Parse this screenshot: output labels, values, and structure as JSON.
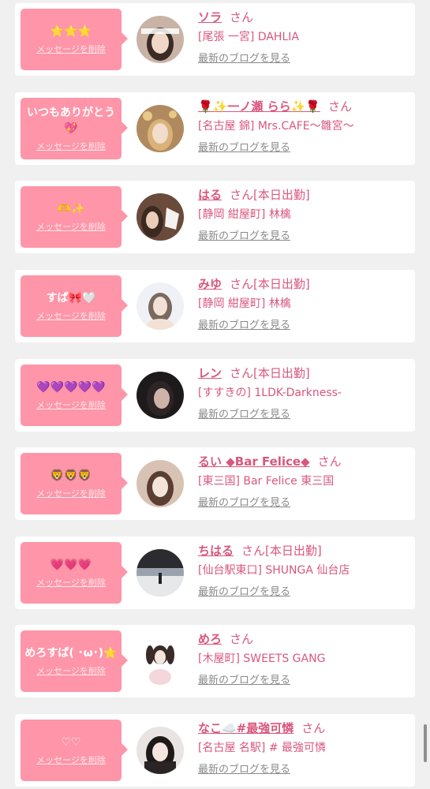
{
  "labels": {
    "delete": "メッセージを削除",
    "san": "さん",
    "blog": "最新のブログを見る"
  },
  "items": [
    {
      "message": "⭐⭐⭐",
      "name": "ソラ",
      "status": "",
      "shop": "[尾張 一宮] DAHLIA"
    },
    {
      "message": "いつもありがとう💖",
      "name": "🌹✨一ノ瀬 らら✨🌹",
      "status": "",
      "shop": "[名古屋 錦] Mrs.CAFE〜雛宮〜"
    },
    {
      "message": "🫶✨",
      "name": "はる",
      "status": "[本日出勤]",
      "shop": "[静岡 紺屋町] 林檎"
    },
    {
      "message": "すぱ🎀🤍",
      "name": "みゆ",
      "status": "[本日出勤]",
      "shop": "[静岡 紺屋町] 林檎"
    },
    {
      "message": "💜💜💜💜💜",
      "name": "レン",
      "status": "[本日出勤]",
      "shop": "[すすきの] 1LDK-Darkness-"
    },
    {
      "message": "🦁🦁🦁",
      "name": "るい ◆Bar Felice◆",
      "status": "",
      "shop": "[東三国] Bar Felice 東三国"
    },
    {
      "message": "💗💗💗",
      "name": "ちはる",
      "status": "[本日出勤]",
      "shop": "[仙台駅東口] SHUNGA 仙台店"
    },
    {
      "message": "めろすぱ( ･ω･)⭐",
      "name": "めろ",
      "status": "",
      "shop": "[木屋町] SWEETS GANG"
    },
    {
      "message": "♡♡",
      "name": "なこ☁️#最強可憐",
      "status": "",
      "shop": "[名古屋 名駅] # 最強可憐"
    }
  ]
}
